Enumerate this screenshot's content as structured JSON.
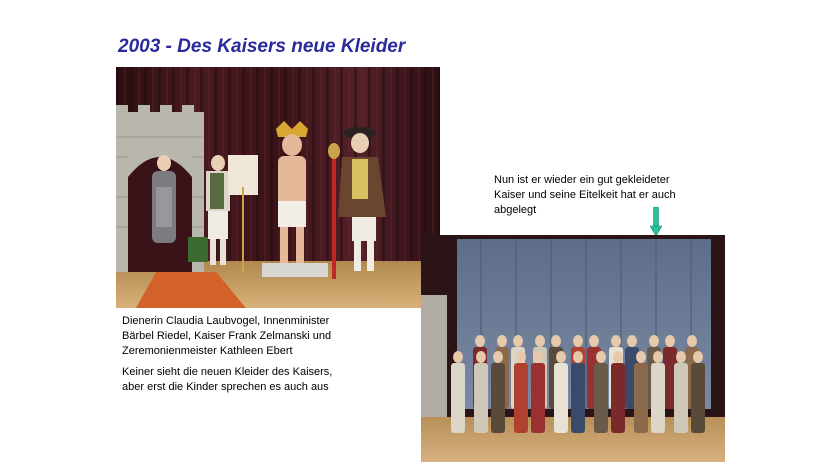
{
  "slide": {
    "title": "2003 - Des Kaisers neue Kleider",
    "caption_lines": [
      "Dienerin Claudia Laubvogel, Innenminister",
      "Bärbel Riedel, Kaiser Frank Zelmanski und",
      "Zeremonienmeister Kathleen Ebert"
    ],
    "caption_second_lines": [
      "Keiner sieht die neuen Kleider des Kaisers,",
      "aber erst die Kinder sprechen es auch aus"
    ],
    "note_lines": [
      "Nun ist er wieder ein gut gekleideter",
      "Kaiser und seine Eitelkeit hat er auch",
      "abgelegt"
    ],
    "colors": {
      "title": "#2b2a9b",
      "arrow": "#2bbf9b"
    }
  }
}
